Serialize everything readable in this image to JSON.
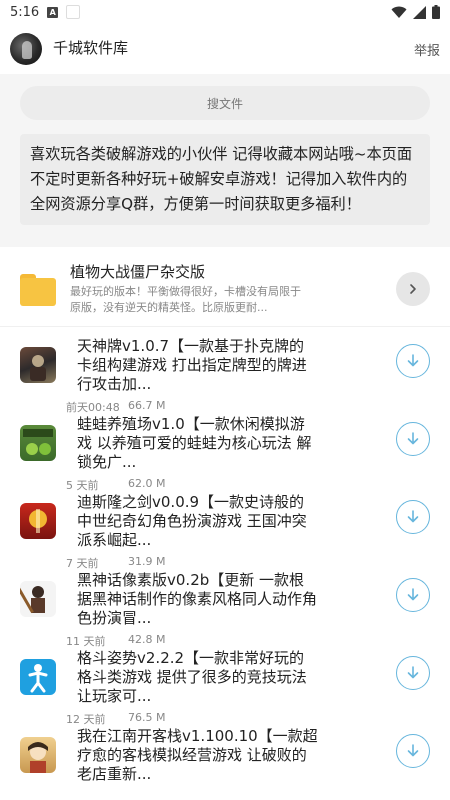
{
  "status": {
    "time": "5:16",
    "notif_icon": "A"
  },
  "header": {
    "title": "千城软件库",
    "report": "举报"
  },
  "search": {
    "placeholder": "搜文件"
  },
  "notice": {
    "text": "喜欢玩各类破解游戏的小伙伴 记得收藏本网站哦~本页面不定时更新各种好玩+破解安卓游戏！记得加入软件内的全网资源分享Q群，方便第一时间获取更多福利！"
  },
  "folder": {
    "title": "植物大战僵尸杂交版",
    "desc": "最好玩的版本！平衡做得很好，卡槽没有局限于原版，没有逆天的精英怪。比原版更耐..."
  },
  "apps": [
    {
      "title": "天神牌v1.0.7【一款基于扑克牌的卡组构建游戏 打出指定牌型的牌进行攻击加...",
      "time": "前天00:48",
      "size": "66.7 M",
      "icon": "tianshen-icon"
    },
    {
      "title": "蛙蛙养殖场v1.0【一款休闲模拟游戏 以养殖可爱的蛙蛙为核心玩法 解锁免广...",
      "time": "5 天前",
      "size": "62.0 M",
      "icon": "frog-farm-icon"
    },
    {
      "title": "迪斯隆之剑v0.0.9【一款史诗般的中世纪奇幻角色扮演游戏 王国冲突派系崛起...",
      "time": "7 天前",
      "size": "31.9 M",
      "icon": "sword-icon"
    },
    {
      "title": "黑神话像素版v0.2b【更新 一款根据黑神话制作的像素风格同人动作角色扮演冒...",
      "time": "11 天前",
      "size": "42.8 M",
      "icon": "black-myth-icon"
    },
    {
      "title": "格斗姿势v2.2.2【一款非常好玩的格斗类游戏 提供了很多的竞技玩法让玩家可...",
      "time": "12 天前",
      "size": "76.5 M",
      "icon": "fight-pose-icon"
    },
    {
      "title": "我在江南开客栈v1.100.10【一款超疗愈的客栈模拟经营游戏 让破败的老店重新...",
      "time": "",
      "size": "",
      "icon": "inn-icon"
    }
  ]
}
